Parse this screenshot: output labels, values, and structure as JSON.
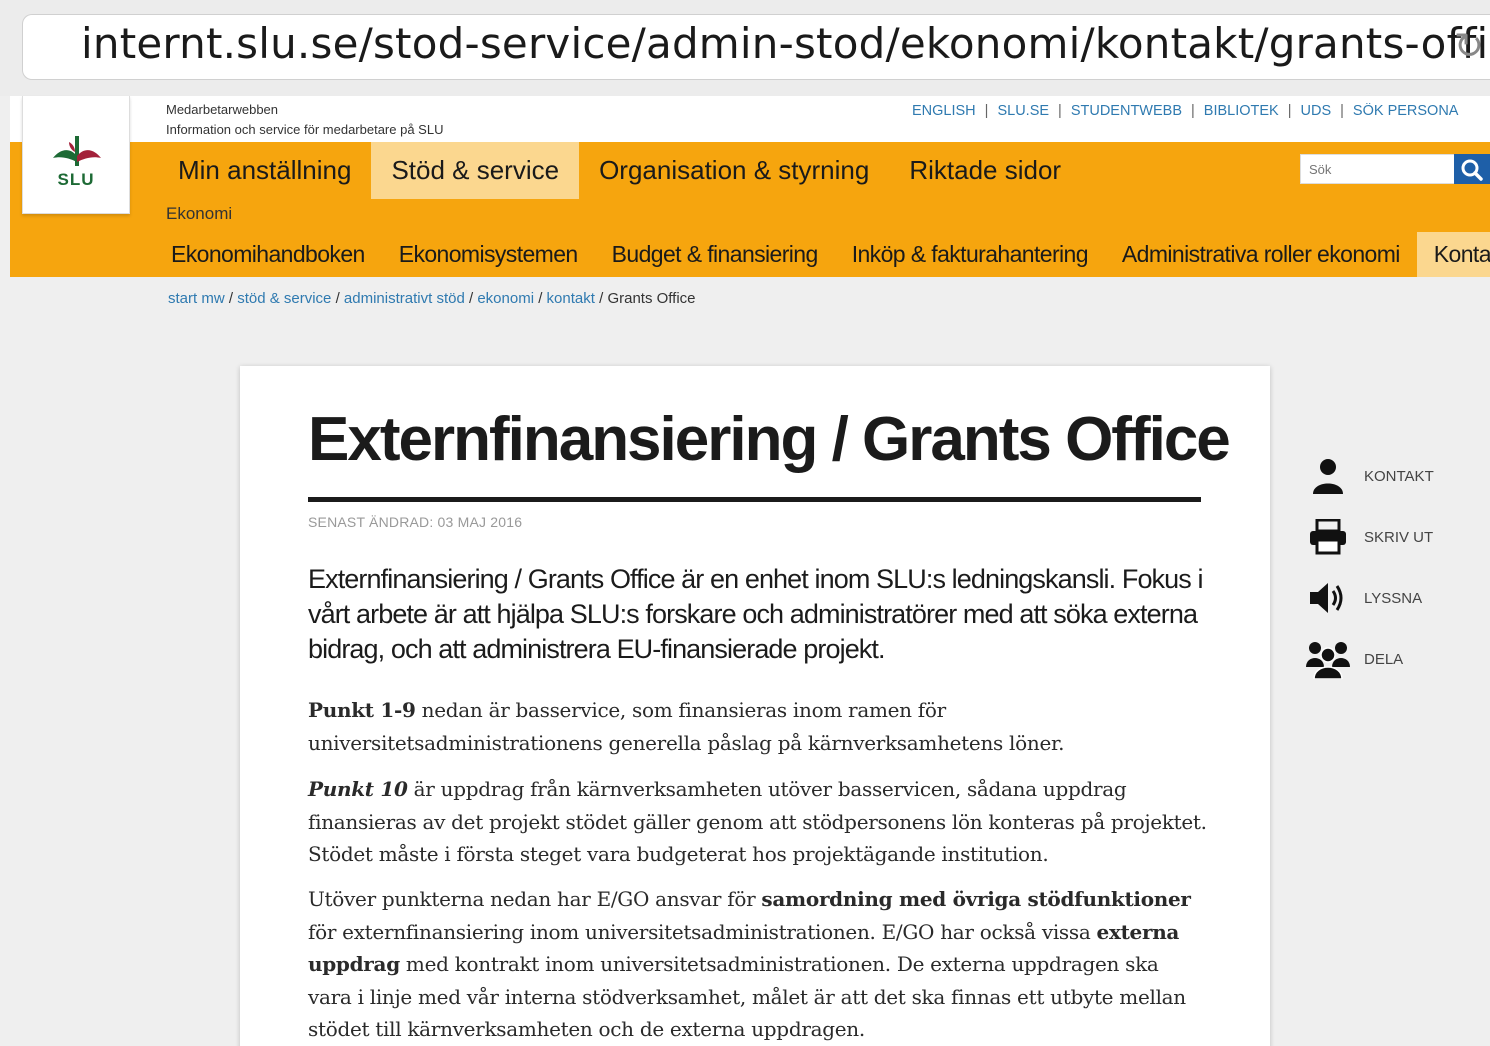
{
  "browser": {
    "url": "internt.slu.se/stod-service/admin-stod/ekonomi/kontakt/grants-office/"
  },
  "header": {
    "logo_text": "SLU",
    "site_name": "Medarbetarwebben",
    "site_sub": "Information och service för medarbetare på SLU",
    "top_links": [
      "ENGLISH",
      "SLU.SE",
      "STUDENTWEBB",
      "BIBLIOTEK",
      "UDS",
      "SÖK PERSONA"
    ],
    "main_nav": [
      "Min anställning",
      "Stöd & service",
      "Organisation & styrning",
      "Riktade sidor"
    ],
    "main_nav_active": "Stöd & service",
    "search_placeholder": "Sök",
    "section": "Ekonomi",
    "sub_nav": [
      "Ekonomihandboken",
      "Ekonomisystemen",
      "Budget & finansiering",
      "Inköp & fakturahantering",
      "Administrativa roller ekonomi",
      "Kontakt"
    ],
    "sub_nav_active": "Kontakt"
  },
  "breadcrumb": {
    "links": [
      "start mw",
      "stöd & service",
      "administrativt stöd",
      "ekonomi",
      "kontakt"
    ],
    "current": "Grants Office"
  },
  "article": {
    "title": "Externfinansiering / Grants Office",
    "updated": "SENAST ÄNDRAD: 03 MAJ 2016",
    "lead": "Externfinansiering / Grants Office är en enhet inom SLU:s ledningskansli. Fokus i vårt arbete är att hjälpa SLU:s forskare och administratörer med att söka externa bidrag, och att administrera EU-finansierade projekt.",
    "p1_bold": "Punkt 1-9",
    "p1_text": " nedan är basservice, som finansieras inom ramen för universitetsadministrationens generella påslag på kärnverksamhetens löner.",
    "p2_italic": "Punkt 10",
    "p2_text": " är uppdrag från kärnverksamheten utöver basservicen, sådana uppdrag finansieras av det projekt stödet gäller genom att stödpersonens lön konteras på projektet. Stödet måste i första steget vara budgeterat hos projektägande institution.",
    "p3_a": "Utöver punkterna nedan har E/GO ansvar för ",
    "p3_b": "samordning med övriga stödfunktioner",
    "p3_c": " för externfinansiering inom universitetsadministrationen. E/GO har också vissa ",
    "p3_d": "externa uppdrag",
    "p3_e": " med kontrakt inom universitetsadministrationen. De externa uppdragen ska vara i linje med vår interna stödverksamhet, målet är att det ska finnas ett utbyte mellan stödet till kärnverksamheten och de externa uppdragen."
  },
  "tools": {
    "contact": "KONTAKT",
    "print": "SKRIV UT",
    "listen": "LYSSNA",
    "share": "DELA"
  }
}
